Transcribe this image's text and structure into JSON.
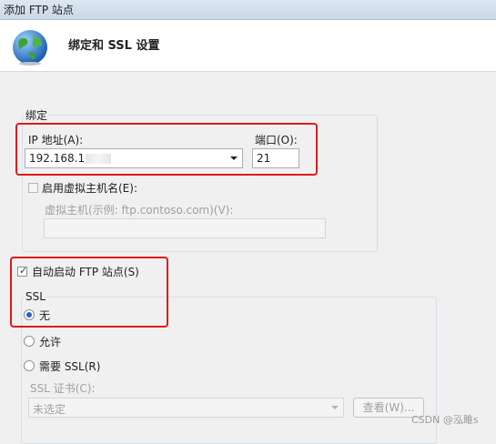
{
  "window": {
    "title": "添加 FTP 站点"
  },
  "header": {
    "title": "绑定和 SSL 设置"
  },
  "binding": {
    "group_label": "绑定",
    "ip_label": "IP 地址(A):",
    "ip_value": "192.168.1",
    "port_label": "端口(O):",
    "port_value": "21",
    "virtual_host_checkbox_label": "启用虚拟主机名(E):",
    "virtual_host_checked": false,
    "virtual_host_label": "虚拟主机(示例: ftp.contoso.com)(V):",
    "virtual_host_value": ""
  },
  "autostart": {
    "label": "自动启动 FTP 站点(S)",
    "checked": true
  },
  "ssl": {
    "group_label": "SSL",
    "options": [
      {
        "label": "无",
        "selected": true
      },
      {
        "label": "允许",
        "selected": false
      },
      {
        "label": "需要 SSL(R)",
        "selected": false
      }
    ],
    "cert_label": "SSL 证书(C):",
    "cert_value": "未选定",
    "view_button": "查看(W)..."
  },
  "watermark": "CSDN @泓雎s",
  "colors": {
    "highlight": "#e01a1a",
    "accent": "#2a62b8"
  }
}
